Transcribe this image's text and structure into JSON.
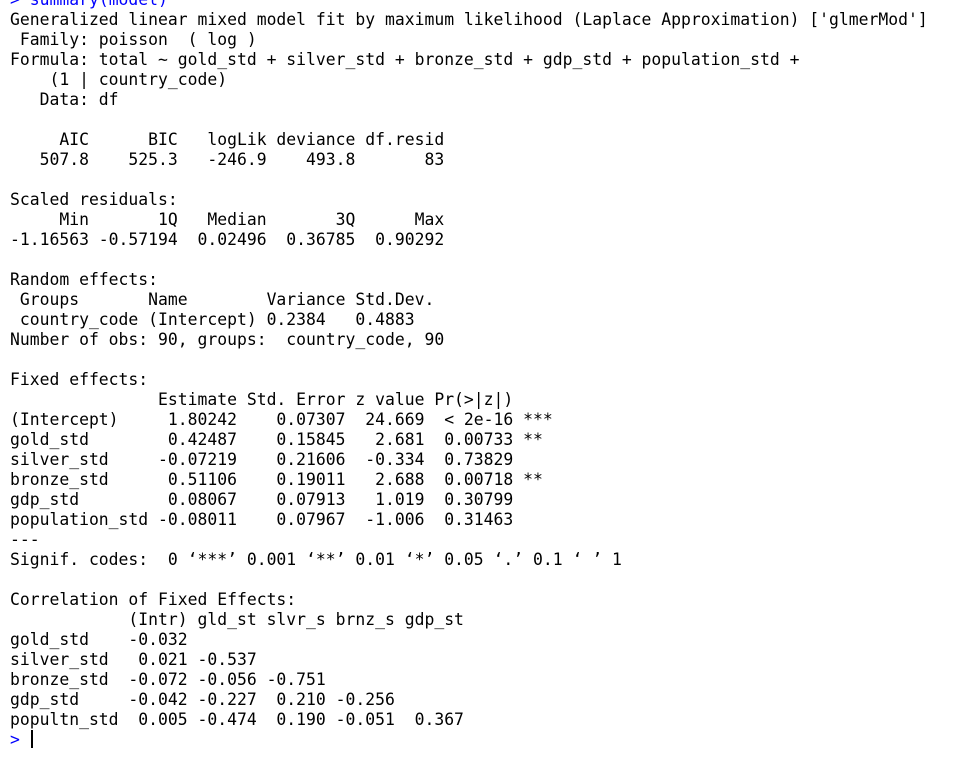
{
  "console": {
    "command_prompt": "> ",
    "command_text": "summary(model)",
    "output_lines": [
      "Generalized linear mixed model fit by maximum likelihood (Laplace Approximation) ['glmerMod']",
      " Family: poisson  ( log )",
      "Formula: total ~ gold_std + silver_std + bronze_std + gdp_std + population_std +",
      "    (1 | country_code)",
      "   Data: df",
      "",
      "     AIC      BIC   logLik deviance df.resid",
      "   507.8    525.3   -246.9    493.8       83",
      "",
      "Scaled residuals:",
      "     Min       1Q   Median       3Q      Max",
      "-1.16563 -0.57194  0.02496  0.36785  0.90292",
      "",
      "Random effects:",
      " Groups       Name        Variance Std.Dev.",
      " country_code (Intercept) 0.2384   0.4883  ",
      "Number of obs: 90, groups:  country_code, 90",
      "",
      "Fixed effects:",
      "               Estimate Std. Error z value Pr(>|z|)    ",
      "(Intercept)     1.80242    0.07307  24.669  < 2e-16 ***",
      "gold_std        0.42487    0.15845   2.681  0.00733 ** ",
      "silver_std     -0.07219    0.21606  -0.334  0.73829    ",
      "bronze_std      0.51106    0.19011   2.688  0.00718 ** ",
      "gdp_std         0.08067    0.07913   1.019  0.30799    ",
      "population_std -0.08011    0.07967  -1.006  0.31463    ",
      "---",
      "Signif. codes:  0 ‘***’ 0.001 ‘**’ 0.01 ‘*’ 0.05 ‘.’ 0.1 ‘ ’ 1",
      "",
      "Correlation of Fixed Effects:",
      "            (Intr) gld_st slvr_s brnz_s gdp_st",
      "gold_std    -0.032                            ",
      "silver_std   0.021 -0.537                     ",
      "bronze_std  -0.072 -0.056 -0.751              ",
      "gdp_std     -0.042 -0.227  0.210 -0.256       ",
      "popultn_std  0.005 -0.474  0.190 -0.051  0.367"
    ],
    "input_prompt": "> "
  },
  "colors": {
    "command": "#0000ff",
    "output": "#000000",
    "background": "#ffffff"
  }
}
